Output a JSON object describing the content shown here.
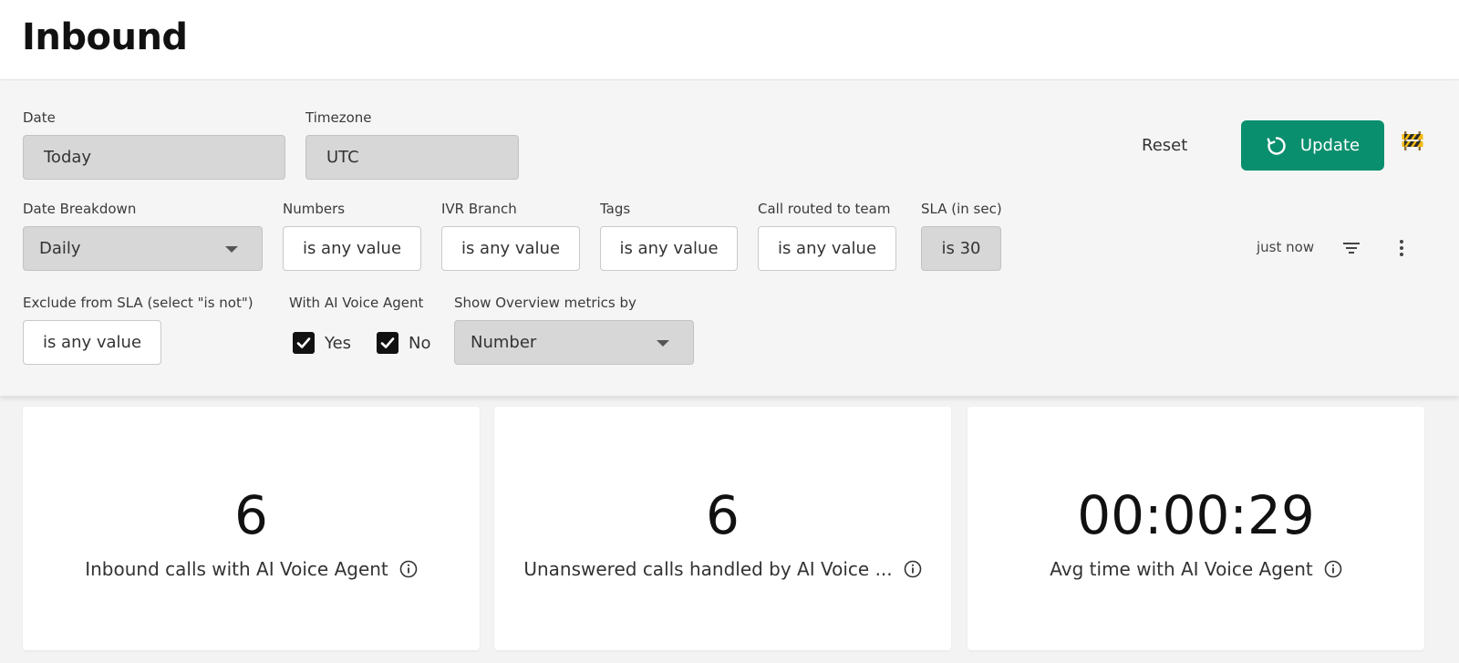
{
  "page": {
    "title": "Inbound"
  },
  "filters": {
    "date": {
      "label": "Date",
      "value": "Today"
    },
    "timezone": {
      "label": "Timezone",
      "value": "UTC"
    },
    "date_breakdown": {
      "label": "Date Breakdown",
      "value": "Daily"
    },
    "numbers": {
      "label": "Numbers",
      "value": "is any value"
    },
    "ivr_branch": {
      "label": "IVR Branch",
      "value": "is any value"
    },
    "tags": {
      "label": "Tags",
      "value": "is any value"
    },
    "call_routed_to_team": {
      "label": "Call routed to team",
      "value": "is any value"
    },
    "sla": {
      "label": "SLA (in sec)",
      "value": "is 30"
    },
    "exclude_from_sla": {
      "label": "Exclude from SLA (select \"is not\")",
      "value": "is any value"
    },
    "ai_voice_agent": {
      "label": "With AI Voice Agent",
      "options": [
        {
          "label": "Yes",
          "checked": true
        },
        {
          "label": "No",
          "checked": true
        }
      ]
    },
    "overview_metrics": {
      "label": "Show Overview metrics by",
      "value": "Number"
    }
  },
  "actions": {
    "reset_label": "Reset",
    "update_label": "Update",
    "last_updated": "just now",
    "accent_color": "#0a8f6e"
  },
  "icons": {
    "update": "refresh-icon",
    "status": "construction-barrier-icon",
    "filter": "filter-lines-icon",
    "more": "vertical-dots-icon",
    "info": "info-circle-icon",
    "dropdown": "caret-down-icon",
    "checkbox": "checkmark-icon"
  },
  "metrics": [
    {
      "value": "6",
      "label": "Inbound calls with AI Voice Agent"
    },
    {
      "value": "6",
      "label": "Unanswered calls handled by AI Voice ..."
    },
    {
      "value": "00:00:29",
      "label": "Avg time with AI Voice Agent"
    }
  ]
}
